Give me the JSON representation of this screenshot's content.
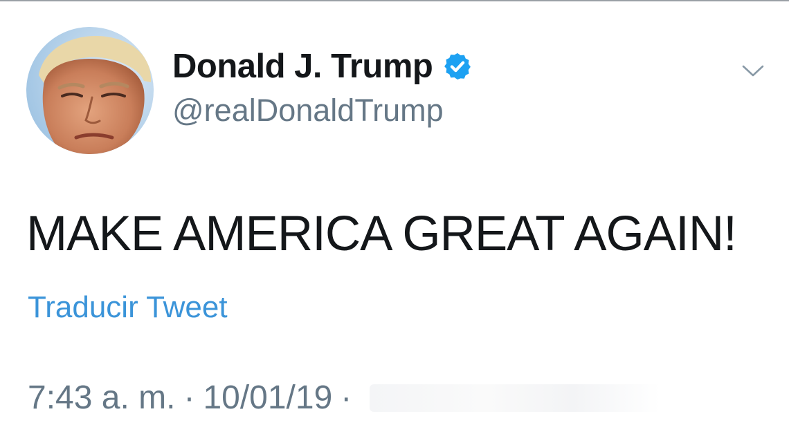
{
  "user": {
    "display_name": "Donald J. Trump",
    "handle": "@realDonaldTrump",
    "verified": true,
    "verified_icon": "verified-badge-icon"
  },
  "tweet": {
    "text": "MAKE AMERICA GREAT AGAIN!",
    "translate_label": "Traducir Tweet",
    "time": "7:43 a. m.",
    "separator": "·",
    "date": "10/01/19",
    "separator_2": "·"
  },
  "icons": {
    "menu": "chevron-down-icon"
  },
  "colors": {
    "text_primary": "#14171a",
    "text_secondary": "#657786",
    "link": "#3b94d9",
    "verified": "#1da1f2"
  }
}
